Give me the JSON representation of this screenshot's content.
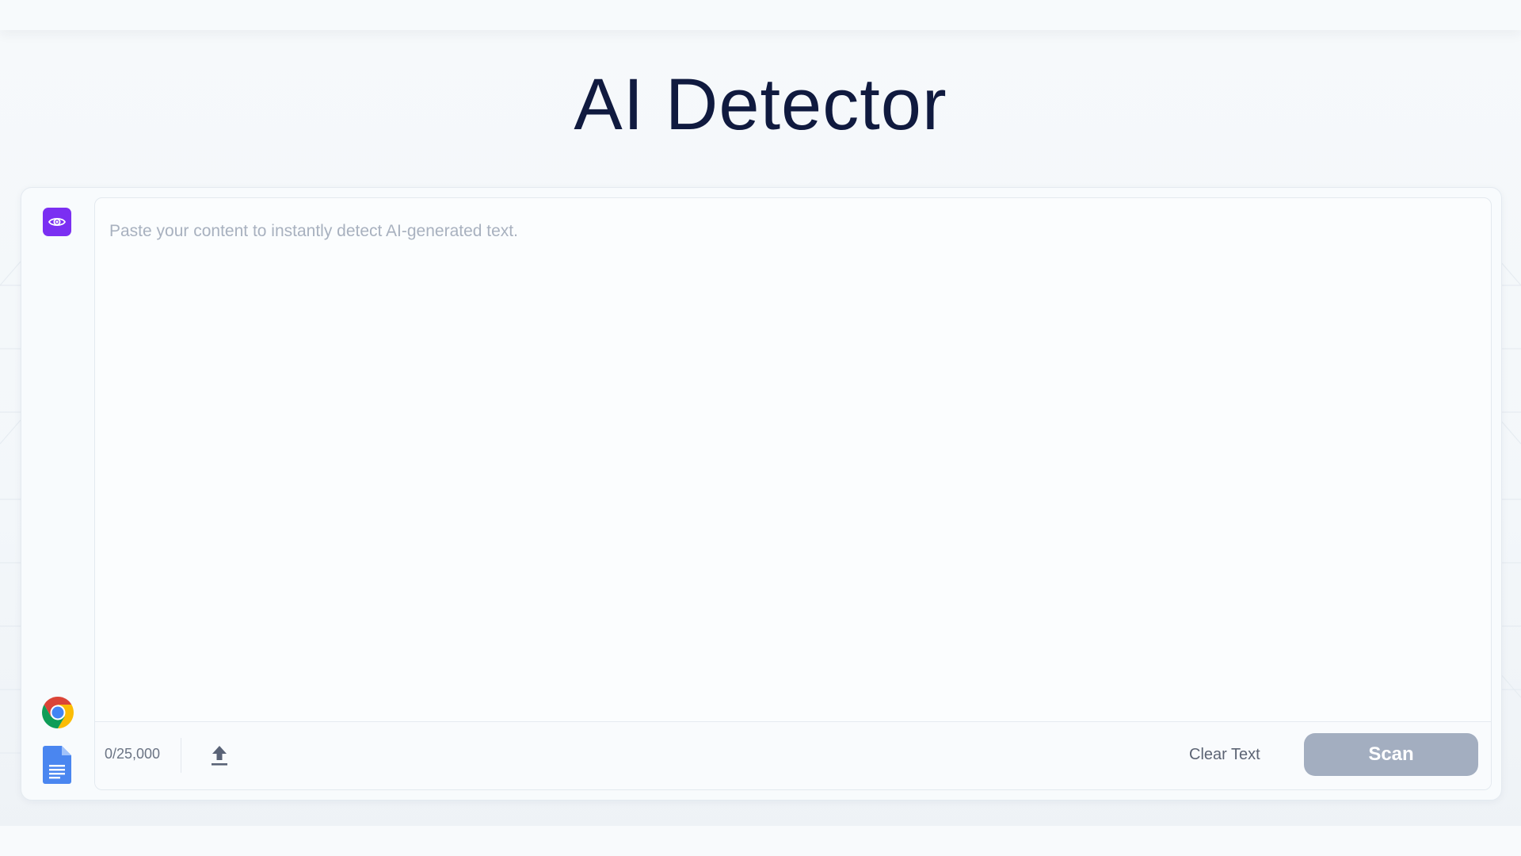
{
  "page": {
    "title": "AI Detector"
  },
  "sidebar": {
    "top_icon": "eye-icon",
    "bottom_icons": [
      "chrome-icon",
      "google-docs-icon"
    ]
  },
  "editor": {
    "placeholder": "Paste your content to instantly detect AI-generated text.",
    "value": ""
  },
  "footer": {
    "counter": "0/25,000",
    "upload_icon": "upload-icon",
    "clear_label": "Clear Text",
    "scan_label": "Scan"
  },
  "colors": {
    "accent": "#7b2ff2",
    "title": "#101a3f",
    "scan_disabled": "#a3aec0"
  }
}
